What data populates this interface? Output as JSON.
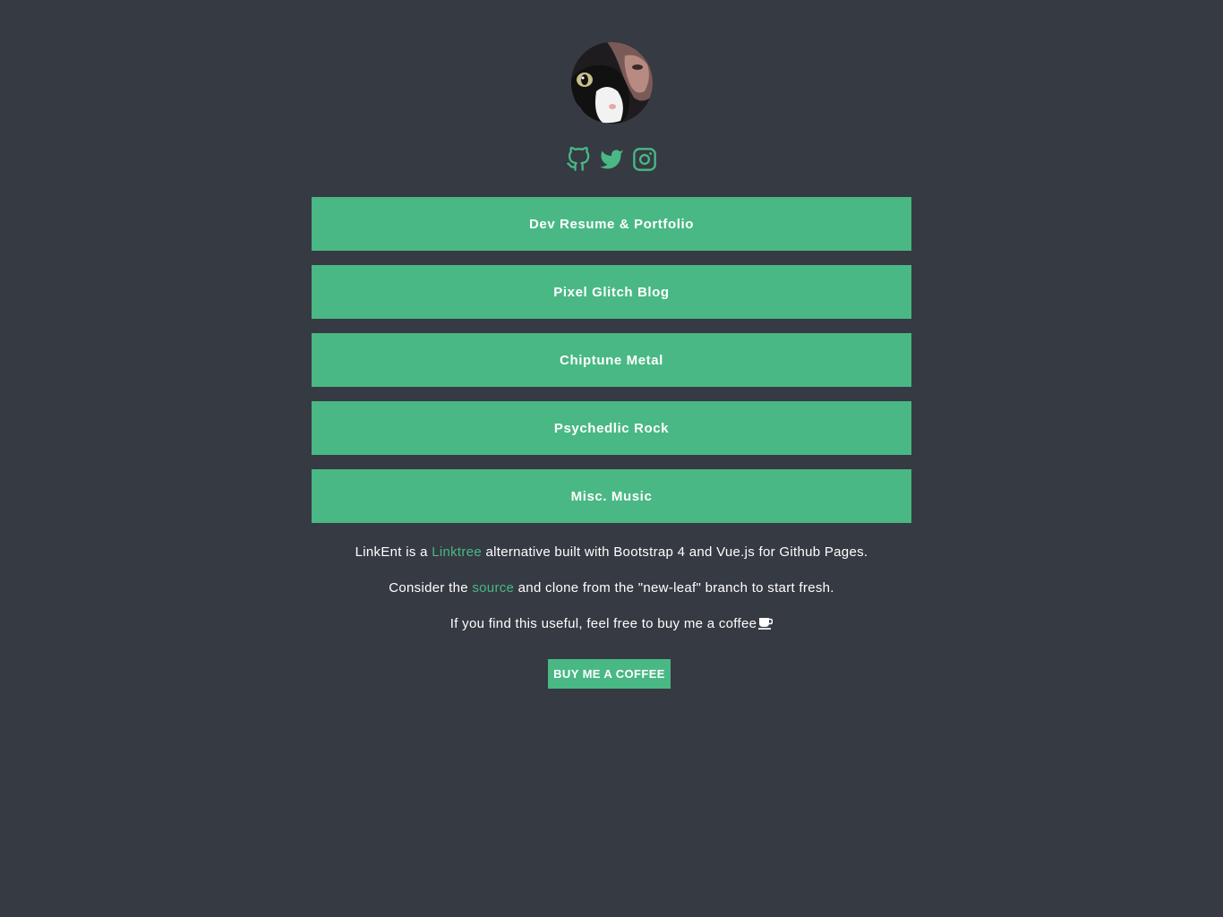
{
  "brand": {
    "accent": "#49b885",
    "background": "#363a42",
    "text": "#ffffff"
  },
  "profile": {
    "avatar": "avatar"
  },
  "social": [
    {
      "name": "GitHub",
      "icon": "github-icon"
    },
    {
      "name": "Twitter",
      "icon": "twitter-icon"
    },
    {
      "name": "Instagram",
      "icon": "instagram-icon"
    }
  ],
  "links": [
    {
      "label": "Dev Resume & Portfolio"
    },
    {
      "label": "Pixel Glitch Blog"
    },
    {
      "label": "Chiptune Metal"
    },
    {
      "label": "Psychedlic Rock"
    },
    {
      "label": "Misc. Music"
    }
  ],
  "footer": {
    "line1": {
      "before": "LinkEnt is a ",
      "link": "Linktree",
      "after": " alternative built with Bootstrap 4 and Vue.js for Github Pages."
    },
    "line2": {
      "before": "Consider the ",
      "link": "source",
      "after": " and clone from the \"new-leaf\" branch to start fresh."
    },
    "line3": {
      "text": "If you find this useful, feel free to buy me a coffee",
      "icon": "coffee-icon"
    },
    "coffee_button": "BUY ME A COFFEE"
  }
}
